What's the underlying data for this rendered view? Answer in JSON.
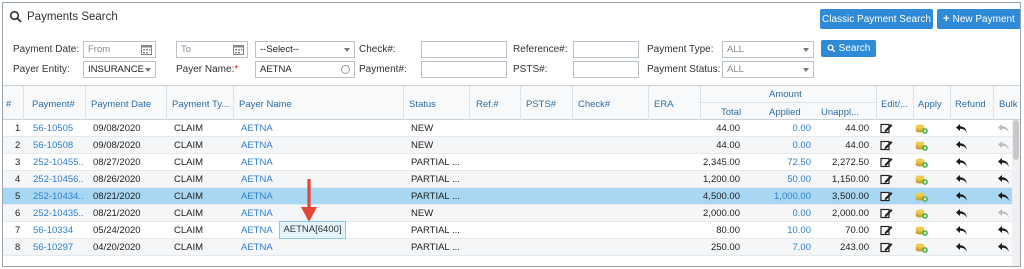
{
  "page": {
    "title": "Payments Search"
  },
  "actions": {
    "classic": "Classic Payment Search",
    "new_label": "New Payment",
    "search": "Search"
  },
  "filters": {
    "payment_date": {
      "label": "Payment Date:",
      "from_placeholder": "From",
      "to_placeholder": "To",
      "preset": "--Select--"
    },
    "payer_entity": {
      "label": "Payer Entity:",
      "value": "INSURANCE"
    },
    "payer_name": {
      "label": "Payer Name:",
      "required": "*",
      "value": "AETNA"
    },
    "check": {
      "label": "Check#:",
      "value": ""
    },
    "payment_no": {
      "label": "Payment#:",
      "value": ""
    },
    "reference": {
      "label": "Reference#:",
      "value": ""
    },
    "psts": {
      "label": "PSTS#:",
      "value": ""
    },
    "payment_type": {
      "label": "Payment Type:",
      "value": "ALL"
    },
    "payment_status": {
      "label": "Payment Status:",
      "value": "ALL"
    }
  },
  "table": {
    "columns": {
      "num": "#",
      "payment": "Payment#",
      "date": "Payment Date",
      "type": "Payment Ty...",
      "payer": "Payer Name",
      "status": "Status",
      "ref": "Ref.#",
      "psts": "PSTS#",
      "check": "Check#",
      "era": "ERA",
      "amount": "Amount",
      "total": "Total",
      "applied": "Applied",
      "unapplied": "Unappl...",
      "edit": "Edit/...",
      "apply": "Apply",
      "refund": "Refund",
      "bulk": "Bulk R"
    },
    "rows": [
      {
        "n": "1",
        "payment": "56-10505",
        "date": "09/08/2020",
        "type": "CLAIM",
        "payer": "AETNA",
        "status": "NEW",
        "total": "44.00",
        "applied": "0.00",
        "unapplied": "44.00"
      },
      {
        "n": "2",
        "payment": "56-10508",
        "date": "09/08/2020",
        "type": "CLAIM",
        "payer": "AETNA",
        "status": "NEW",
        "total": "44.00",
        "applied": "0.00",
        "unapplied": "44.00"
      },
      {
        "n": "3",
        "payment": "252-10455...",
        "date": "08/27/2020",
        "type": "CLAIM",
        "payer": "AETNA",
        "status": "PARTIAL ...",
        "total": "2,345.00",
        "applied": "72.50",
        "unapplied": "2,272.50"
      },
      {
        "n": "4",
        "payment": "252-10456...",
        "date": "08/26/2020",
        "type": "CLAIM",
        "payer": "AETNA",
        "status": "PARTIAL ...",
        "total": "1,200.00",
        "applied": "50.00",
        "unapplied": "1,150.00"
      },
      {
        "n": "5",
        "payment": "252-10434...",
        "date": "08/21/2020",
        "type": "CLAIM",
        "payer": "AETNA",
        "status": "PARTIAL ...",
        "total": "4,500.00",
        "applied": "1,000.00",
        "unapplied": "3,500.00"
      },
      {
        "n": "6",
        "payment": "252-10435...",
        "date": "08/21/2020",
        "type": "CLAIM",
        "payer": "AETNA",
        "status": "NEW",
        "total": "2,000.00",
        "applied": "0.00",
        "unapplied": "2,000.00"
      },
      {
        "n": "7",
        "payment": "56-10334",
        "date": "05/24/2020",
        "type": "CLAIM",
        "payer": "AETNA",
        "status": "PARTIAL ...",
        "total": "80.00",
        "applied": "10.00",
        "unapplied": "70.00"
      },
      {
        "n": "8",
        "payment": "56-10297",
        "date": "04/20/2020",
        "type": "CLAIM",
        "payer": "AETNA",
        "status": "PARTIAL ...",
        "total": "250.00",
        "applied": "7.00",
        "unapplied": "243.00"
      }
    ]
  },
  "tooltip": {
    "text": "AETNA[6400]"
  },
  "colors": {
    "accent": "#2f8ad8",
    "selected_row": "#a8d7f3",
    "link": "#2f7fcf",
    "arrow": "#e2473a"
  }
}
